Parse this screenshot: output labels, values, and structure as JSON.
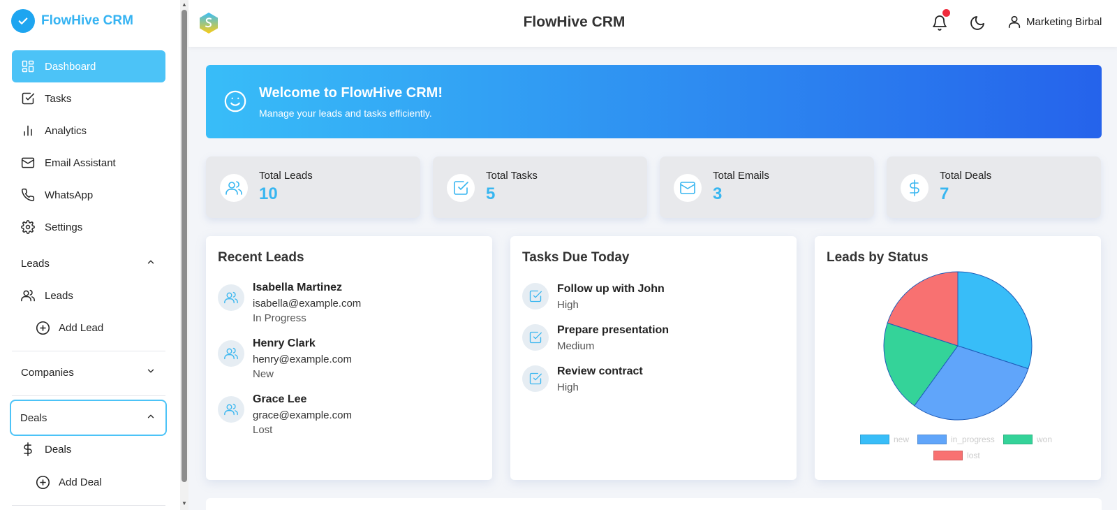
{
  "app": {
    "name": "FlowHive CRM"
  },
  "sidebar": {
    "nav": [
      {
        "label": "Dashboard",
        "icon": "grid-icon"
      },
      {
        "label": "Tasks",
        "icon": "checkbox-icon"
      },
      {
        "label": "Analytics",
        "icon": "bar-chart-icon"
      },
      {
        "label": "Email Assistant",
        "icon": "mail-icon"
      },
      {
        "label": "WhatsApp",
        "icon": "phone-icon"
      },
      {
        "label": "Settings",
        "icon": "gear-icon"
      }
    ],
    "leads_section": {
      "label": "Leads",
      "items": [
        "Leads",
        "Add Lead"
      ]
    },
    "companies_section": {
      "label": "Companies"
    },
    "deals_section": {
      "label": "Deals",
      "items": [
        "Deals",
        "Add Deal"
      ]
    }
  },
  "header": {
    "title": "FlowHive CRM",
    "user": "Marketing Birbal"
  },
  "welcome": {
    "title": "Welcome to FlowHive CRM!",
    "subtitle": "Manage your leads and tasks efficiently."
  },
  "stats": [
    {
      "label": "Total Leads",
      "value": "10",
      "icon": "users-icon"
    },
    {
      "label": "Total Tasks",
      "value": "5",
      "icon": "checkbox-icon"
    },
    {
      "label": "Total Emails",
      "value": "3",
      "icon": "mail-icon"
    },
    {
      "label": "Total Deals",
      "value": "7",
      "icon": "dollar-icon"
    }
  ],
  "recent_leads": {
    "title": "Recent Leads",
    "items": [
      {
        "name": "Isabella Martinez",
        "email": "isabella@example.com",
        "status": "In Progress"
      },
      {
        "name": "Henry Clark",
        "email": "henry@example.com",
        "status": "New"
      },
      {
        "name": "Grace Lee",
        "email": "grace@example.com",
        "status": "Lost"
      }
    ]
  },
  "tasks_due": {
    "title": "Tasks Due Today",
    "items": [
      {
        "name": "Follow up with John",
        "priority": "High"
      },
      {
        "name": "Prepare presentation",
        "priority": "Medium"
      },
      {
        "name": "Review contract",
        "priority": "High"
      }
    ]
  },
  "leads_by_status": {
    "title": "Leads by Status"
  },
  "chart_data": {
    "type": "pie",
    "title": "Leads by Status",
    "categories": [
      "new",
      "in_progress",
      "won",
      "lost"
    ],
    "values": [
      3,
      3,
      2,
      2
    ],
    "colors": [
      "#38bdf8",
      "#60a5fa",
      "#34d399",
      "#f87171"
    ],
    "legend": "bottom"
  },
  "colors": {
    "accent": "#4cc3f7",
    "brand": "#35b3f2",
    "stat_value": "#38b6f0",
    "notification": "#ef2b3c"
  }
}
